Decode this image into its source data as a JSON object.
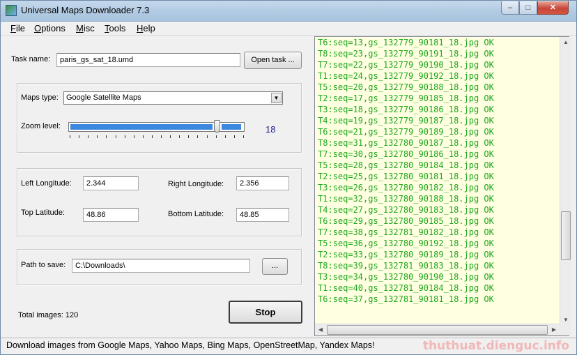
{
  "window": {
    "title": "Universal Maps Downloader 7.3",
    "minimize_glyph": "–",
    "maximize_glyph": "□",
    "close_glyph": "✕"
  },
  "menu": [
    {
      "accel": "F",
      "rest": "ile"
    },
    {
      "accel": "O",
      "rest": "ptions"
    },
    {
      "accel": "M",
      "rest": "isc"
    },
    {
      "accel": "T",
      "rest": "ools"
    },
    {
      "accel": "H",
      "rest": "elp"
    }
  ],
  "task": {
    "label": "Task name:",
    "value": "paris_gs_sat_18.umd",
    "open_button": "Open task ..."
  },
  "maps": {
    "type_label": "Maps type:",
    "type_value": "Google Satellite Maps",
    "zoom_label": "Zoom level:",
    "zoom_value": "18",
    "zoom_fraction": 0.86
  },
  "coords": {
    "left_lon_label": "Left Longitude:",
    "left_lon": "2.344",
    "right_lon_label": "Right Longitude:",
    "right_lon": "2.356",
    "top_lat_label": "Top Latitude:",
    "top_lat": "48.86",
    "bottom_lat_label": "Bottom Latitude:",
    "bottom_lat": "48.85"
  },
  "path": {
    "label": "Path to save:",
    "value": "C:\\Downloads\\",
    "browse_button": "..."
  },
  "total": {
    "label": "Total images:",
    "value": "120"
  },
  "stop_button": "Stop",
  "log": [
    "T6:seq=13,gs_132779_90181_18.jpg OK",
    "T8:seq=23,gs_132779_90191_18.jpg OK",
    "T7:seq=22,gs_132779_90190_18.jpg OK",
    "T1:seq=24,gs_132779_90192_18.jpg OK",
    "T5:seq=20,gs_132779_90188_18.jpg OK",
    "T2:seq=17,gs_132779_90185_18.jpg OK",
    "T3:seq=18,gs_132779_90186_18.jpg OK",
    "T4:seq=19,gs_132779_90187_18.jpg OK",
    "T6:seq=21,gs_132779_90189_18.jpg OK",
    "T8:seq=31,gs_132780_90187_18.jpg OK",
    "T7:seq=30,gs_132780_90186_18.jpg OK",
    "T5:seq=28,gs_132780_90184_18.jpg OK",
    "T2:seq=25,gs_132780_90181_18.jpg OK",
    "T3:seq=26,gs_132780_90182_18.jpg OK",
    "T1:seq=32,gs_132780_90188_18.jpg OK",
    "T4:seq=27,gs_132780_90183_18.jpg OK",
    "T6:seq=29,gs_132780_90185_18.jpg OK",
    "T7:seq=38,gs_132781_90182_18.jpg OK",
    "T5:seq=36,gs_132780_90192_18.jpg OK",
    "T2:seq=33,gs_132780_90189_18.jpg OK",
    "T8:seq=39,gs_132781_90183_18.jpg OK",
    "T3:seq=34,gs_132780_90190_18.jpg OK",
    "T1:seq=40,gs_132781_90184_18.jpg OK",
    "T6:seq=37,gs_132781_90181_18.jpg OK"
  ],
  "log_color": "#1ea81e",
  "log_scroll_fraction": 0.75,
  "status": "Download images from Google Maps, Yahoo Maps, Bing Maps, OpenStreetMap, Yandex Maps!",
  "watermark": "thuthuat.dienguc.info",
  "icons": {
    "app": "app-map-icon",
    "scroll_up": "▲",
    "scroll_down": "▼",
    "scroll_left": "◀",
    "scroll_right": "▶",
    "dropdown": "▼"
  }
}
